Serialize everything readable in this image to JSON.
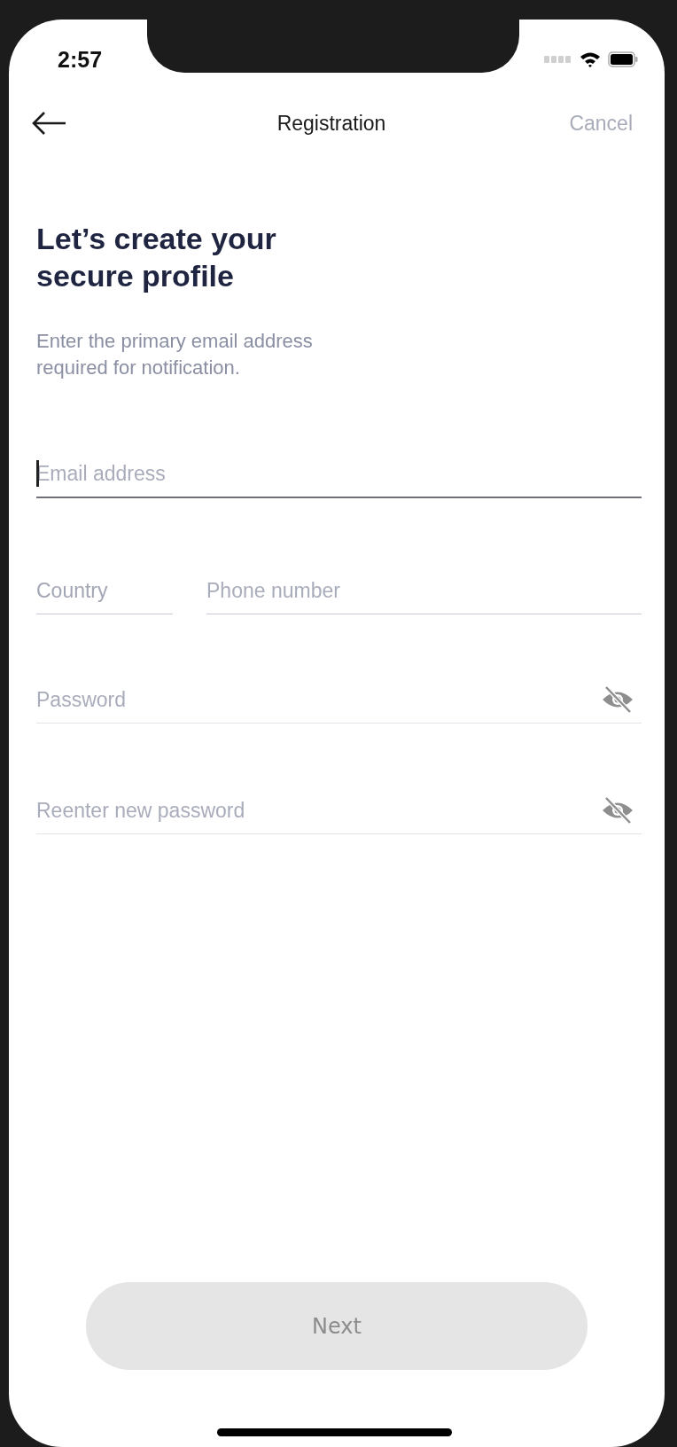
{
  "status_bar": {
    "time": "2:57"
  },
  "nav": {
    "title": "Registration",
    "cancel": "Cancel"
  },
  "heading": "Let’s create your secure profile",
  "subtitle": "Enter the primary email address required for notification.",
  "email": {
    "placeholder": "Email address",
    "focused": true
  },
  "phone": {
    "country": {
      "placeholder": "Country"
    },
    "number": {
      "placeholder": "Phone number"
    }
  },
  "passwords": [
    {
      "placeholder": "Password",
      "visible": false
    },
    {
      "placeholder": "Reenter new password",
      "visible": false
    }
  ],
  "next_button": {
    "label": "Next",
    "disabled": true
  }
}
